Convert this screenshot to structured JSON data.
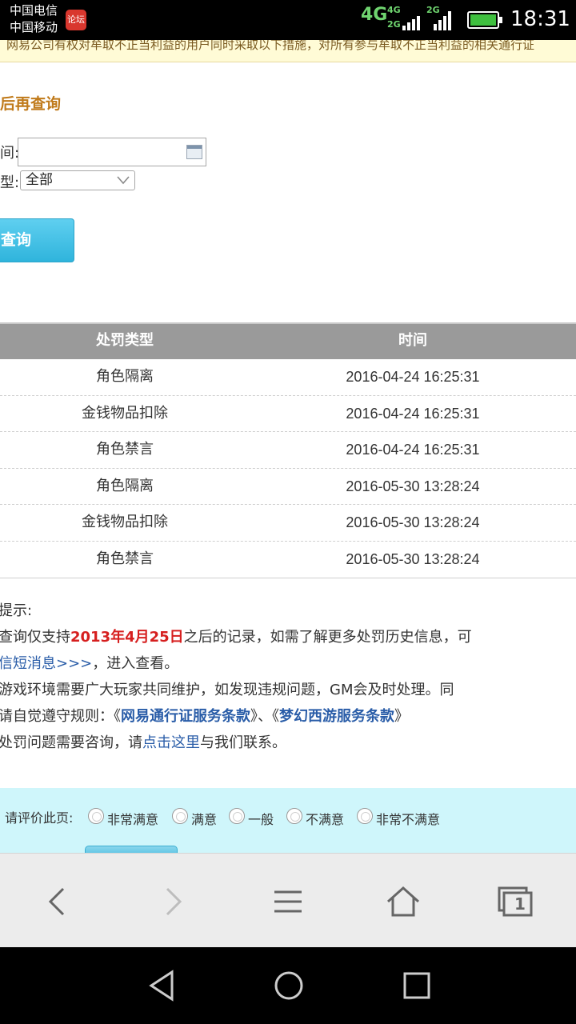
{
  "status_bar": {
    "carrier1": "中国电信",
    "carrier2": "中国移动",
    "app_badge": "论坛",
    "network_main": "4G",
    "network_sub1": "4G",
    "network_sub2": "2G",
    "network_sub3": "2G",
    "time": "18:31"
  },
  "notice": {
    "text": "网易公司有权对牟取不正当利益的用户同时采取以下措施，对所有参与牟取不正当利益的相关通行证"
  },
  "form": {
    "section_title": "后再查询",
    "date_label": "间:",
    "type_label": "型:",
    "type_value": "全部",
    "query_button": "查询"
  },
  "table": {
    "headers": [
      "处罚类型",
      "时间"
    ],
    "rows": [
      {
        "type": "角色隔离",
        "time": "2016-04-24 16:25:31"
      },
      {
        "type": "金钱物品扣除",
        "time": "2016-04-24 16:25:31"
      },
      {
        "type": "角色禁言",
        "time": "2016-04-24 16:25:31"
      },
      {
        "type": "角色隔离",
        "time": "2016-05-30 13:28:24"
      },
      {
        "type": "金钱物品扣除",
        "time": "2016-05-30 13:28:24"
      },
      {
        "type": "角色禁言",
        "time": "2016-05-30 13:28:24"
      }
    ]
  },
  "tips": {
    "title": "提示:",
    "line1_a": "查询仅支持",
    "line1_date": "2013年4月25日",
    "line1_b": "之后的记录，如需了解更多处罚历史信息，可",
    "line2_link": "信短消息>>>",
    "line2_b": "，进入查看。",
    "line3": "游戏环境需要广大玩家共同维护，如发现违规问题，GM会及时处理。同",
    "line4_a": "请自觉遵守规则：《",
    "line4_link1": "网易通行证服务条款",
    "line4_mid": "》、《",
    "line4_link2": "梦幻西游服务条款",
    "line4_end": "》",
    "line5_a": "处罚问题需要咨询，请",
    "line5_link": "点击这里",
    "line5_b": "与我们联系。"
  },
  "rating": {
    "label": "请评价此页:",
    "options": [
      "非常满意",
      "满意",
      "一般",
      "不满意",
      "非常不满意"
    ]
  },
  "browser": {
    "tab_count": "1"
  },
  "colors": {
    "table_header": "#9a9a9a",
    "accent_orange": "#c07a1a",
    "link_blue": "#2a5da8",
    "highlight_red": "#d61f1f",
    "button_blue": "#2fb4dc",
    "rating_bg": "#cff6fb"
  }
}
